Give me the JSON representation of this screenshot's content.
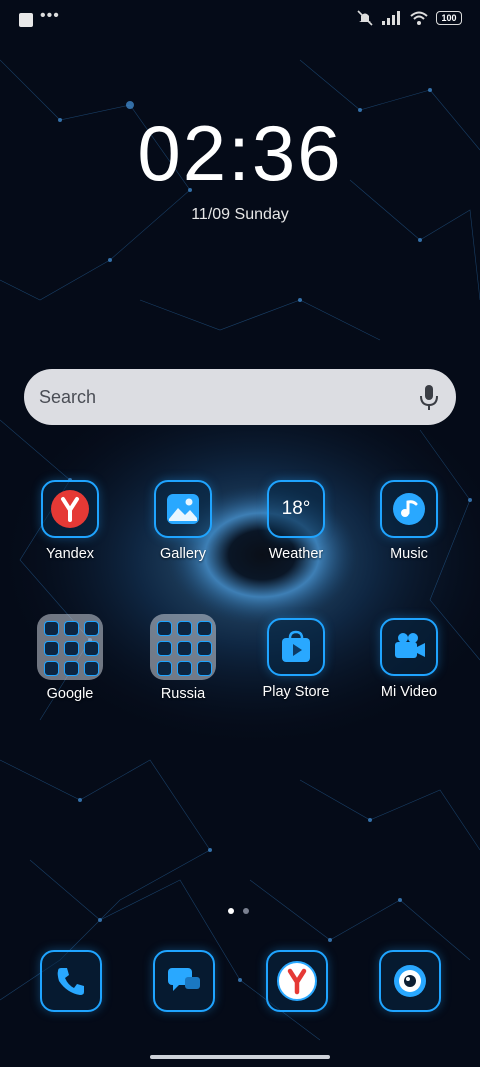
{
  "statusbar": {
    "battery": "100",
    "left_icons": [
      "notification-square-icon",
      "more-dots-icon"
    ],
    "right_icons": [
      "mute-icon",
      "signal-icon",
      "wifi-icon",
      "battery-icon"
    ]
  },
  "lockclock": {
    "time": "02:36",
    "date": "11/09 Sunday"
  },
  "search": {
    "placeholder": "Search"
  },
  "apps": [
    {
      "label": "Yandex",
      "icon": "yandex-icon"
    },
    {
      "label": "Gallery",
      "icon": "gallery-icon"
    },
    {
      "label": "Weather",
      "icon": "weather-icon",
      "value": "18°"
    },
    {
      "label": "Music",
      "icon": "music-icon"
    },
    {
      "label": "Google",
      "icon": "folder-icon"
    },
    {
      "label": "Russia",
      "icon": "folder-icon"
    },
    {
      "label": "Play Store",
      "icon": "play-store-icon"
    },
    {
      "label": "Mi Video",
      "icon": "video-camera-icon"
    }
  ],
  "dock": [
    {
      "icon": "phone-icon"
    },
    {
      "icon": "messages-icon"
    },
    {
      "icon": "yandex-browser-icon"
    },
    {
      "icon": "camera-icon"
    }
  ],
  "pager": {
    "pages": 2,
    "current": 1
  },
  "colors": {
    "accent": "#1fa4ff",
    "background": "#050b18",
    "yandex_red": "#e53935"
  }
}
